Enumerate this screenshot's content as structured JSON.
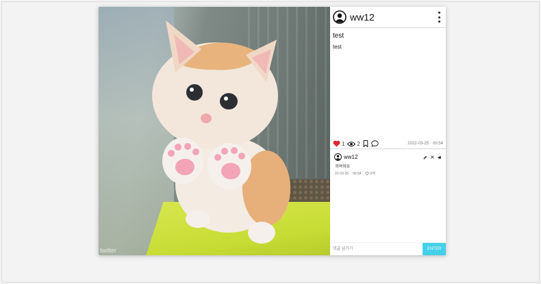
{
  "post": {
    "photo_watermark": "twitter",
    "author": "ww12",
    "title": "test",
    "content": "test",
    "likes": "1",
    "views": "2",
    "date": "2022-03-25",
    "time": "00:54",
    "accent_color": "#e0242e"
  },
  "comments": [
    {
      "author": "ww12",
      "text": "귀여워요",
      "date": "22-03-25",
      "time": "00:54",
      "likes": "0개"
    }
  ],
  "comment_box": {
    "placeholder": "댓글 남기기",
    "submit_label": "ENTER",
    "submit_color": "#43d0e8"
  },
  "icons": [
    "user-avatar-icon",
    "more-vertical-icon",
    "heart-icon",
    "eye-icon",
    "bookmark-icon",
    "comment-bubble-icon",
    "pencil-icon",
    "close-icon",
    "megaphone-icon"
  ]
}
